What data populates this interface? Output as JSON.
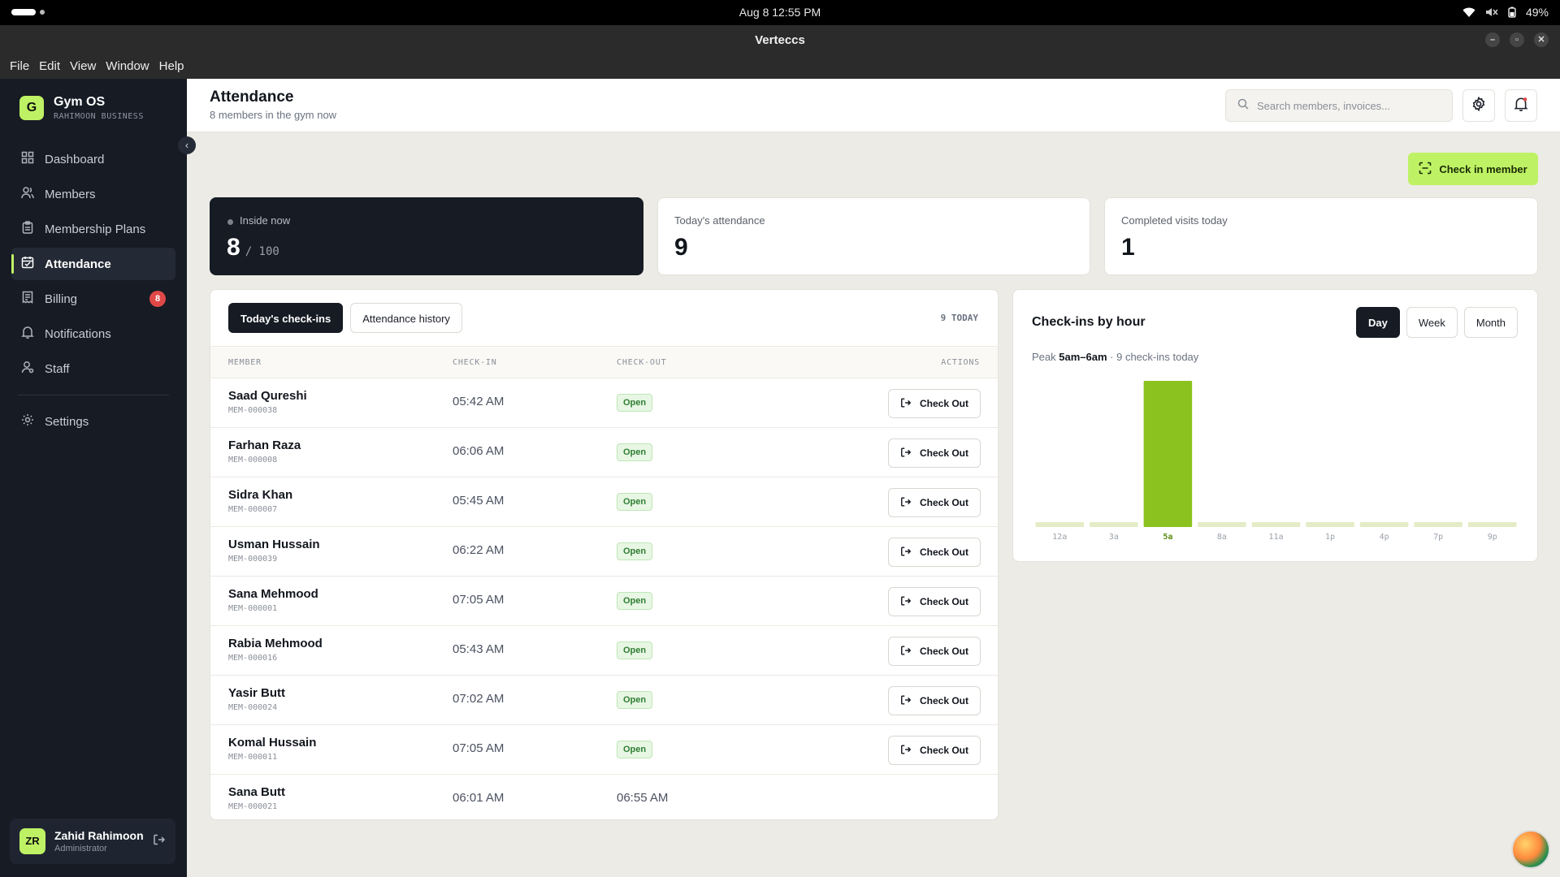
{
  "os": {
    "clock": "Aug 8  12:55 PM",
    "battery": "49%"
  },
  "window": {
    "title": "Vertecсs"
  },
  "menu": [
    "File",
    "Edit",
    "View",
    "Window",
    "Help"
  ],
  "brand": {
    "logo_letter": "G",
    "name": "Gym OS",
    "subtitle": "RAHIMOON BUSINESS"
  },
  "sidebar": {
    "items": [
      {
        "label": "Dashboard",
        "icon": "dashboard-icon"
      },
      {
        "label": "Members",
        "icon": "users-icon"
      },
      {
        "label": "Membership Plans",
        "icon": "clipboard-icon"
      },
      {
        "label": "Attendance",
        "icon": "calendar-icon",
        "active": true
      },
      {
        "label": "Billing",
        "icon": "receipt-icon",
        "badge": "8"
      },
      {
        "label": "Notifications",
        "icon": "bell-icon"
      },
      {
        "label": "Staff",
        "icon": "user-icon"
      }
    ],
    "settings_label": "Settings",
    "user": {
      "initials": "ZR",
      "name": "Zahid Rahimoon",
      "role": "Administrator"
    }
  },
  "header": {
    "title": "Attendance",
    "subtitle": "8 members in the gym now",
    "search_placeholder": "Search members, invoices..."
  },
  "check_in_label": "Check in member",
  "stats": {
    "inside": {
      "label": "Inside now",
      "value": "8",
      "capacity": "/ 100"
    },
    "today": {
      "label": "Today's attendance",
      "value": "9"
    },
    "completed": {
      "label": "Completed visits today",
      "value": "1"
    }
  },
  "table": {
    "tabs": [
      "Today's check-ins",
      "Attendance history"
    ],
    "count_label": "9 TODAY",
    "columns": [
      "MEMBER",
      "CHECK-IN",
      "CHECK-OUT",
      "ACTIONS"
    ],
    "action_label": "Check Out",
    "open_label": "Open",
    "rows": [
      {
        "name": "Saad Qureshi",
        "id": "MEM-000038",
        "check_in": "05:42 AM",
        "check_out": null
      },
      {
        "name": "Farhan Raza",
        "id": "MEM-000008",
        "check_in": "06:06 AM",
        "check_out": null
      },
      {
        "name": "Sidra Khan",
        "id": "MEM-000007",
        "check_in": "05:45 AM",
        "check_out": null
      },
      {
        "name": "Usman Hussain",
        "id": "MEM-000039",
        "check_in": "06:22 AM",
        "check_out": null
      },
      {
        "name": "Sana Mehmood",
        "id": "MEM-000001",
        "check_in": "07:05 AM",
        "check_out": null
      },
      {
        "name": "Rabia Mehmood",
        "id": "MEM-000016",
        "check_in": "05:43 AM",
        "check_out": null
      },
      {
        "name": "Yasir Butt",
        "id": "MEM-000024",
        "check_in": "07:02 AM",
        "check_out": null
      },
      {
        "name": "Komal Hussain",
        "id": "MEM-000011",
        "check_in": "07:05 AM",
        "check_out": null
      },
      {
        "name": "Sana Butt",
        "id": "MEM-000021",
        "check_in": "06:01 AM",
        "check_out": "06:55 AM"
      }
    ]
  },
  "chart_panel": {
    "title": "Check-ins by hour",
    "ranges": [
      "Day",
      "Week",
      "Month"
    ],
    "active_range": "Day",
    "peak_prefix": "Peak",
    "peak_window": "5am–6am",
    "peak_suffix": "· 9 check-ins today"
  },
  "chart_data": {
    "type": "bar",
    "categories": [
      "12a",
      "3a",
      "5a",
      "8a",
      "11a",
      "1p",
      "4p",
      "7p",
      "9p"
    ],
    "values": [
      0,
      0,
      9,
      0,
      0,
      0,
      0,
      0,
      0
    ],
    "highlight": "5a",
    "ylim": [
      0,
      9
    ],
    "colors": {
      "bar": "#8cc21f",
      "empty": "#e3ecc6",
      "highlight_label": "#5c8a12"
    },
    "grid": false
  },
  "colors": {
    "accent": "#bef264",
    "dark": "#161b24",
    "badge": "#e04848"
  }
}
